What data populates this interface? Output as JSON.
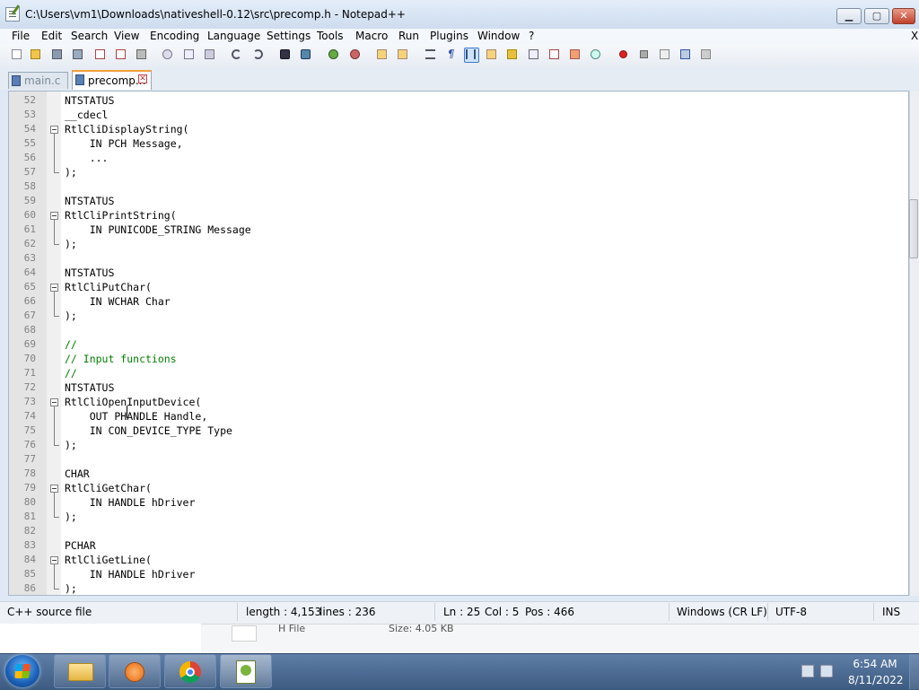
{
  "window": {
    "title": "C:\\Users\\vm1\\Downloads\\nativeshell-0.12\\src\\precomp.h - Notepad++",
    "minimize": "▁",
    "maximize": "▢",
    "close": "✕"
  },
  "menu": [
    "File",
    "Edit",
    "Search",
    "View",
    "Encoding",
    "Language",
    "Settings",
    "Tools",
    "Macro",
    "Run",
    "Plugins",
    "Window",
    "?"
  ],
  "menu_close": "X",
  "toolbar": {
    "icons": [
      "new-file-icon",
      "open-file-icon",
      "save-icon",
      "save-all-icon",
      "close-icon",
      "close-all-icon",
      "print-icon",
      "cut-icon",
      "copy-icon",
      "paste-icon",
      "undo-icon",
      "redo-icon",
      "find-icon",
      "replace-icon",
      "zoom-in-icon",
      "zoom-out-icon",
      "sync-vertical-icon",
      "sync-horizontal-icon",
      "word-wrap-icon",
      "show-all-chars-icon",
      "indent-guide-icon",
      "user-lang-icon",
      "doc-map-icon",
      "function-list-icon",
      "folder-workspace-icon",
      "monitoring-icon",
      "record-macro-icon",
      "stop-record-icon",
      "play-macro-icon",
      "run-macro-multiple-icon",
      "save-macro-icon"
    ]
  },
  "tabs": [
    {
      "label": "main.c",
      "active": false
    },
    {
      "label": "precomp.h",
      "active": true
    }
  ],
  "editor": {
    "lines": [
      {
        "n": "52",
        "text": "NTSTATUS"
      },
      {
        "n": "53",
        "text": "__cdecl"
      },
      {
        "n": "54",
        "text": "RtlCliDisplayString("
      },
      {
        "n": "55",
        "text": "    IN PCH Message,"
      },
      {
        "n": "56",
        "text": "    ..."
      },
      {
        "n": "57",
        "text": ");"
      },
      {
        "n": "58",
        "text": ""
      },
      {
        "n": "59",
        "text": "NTSTATUS"
      },
      {
        "n": "60",
        "text": "RtlCliPrintString("
      },
      {
        "n": "61",
        "text": "    IN PUNICODE_STRING Message"
      },
      {
        "n": "62",
        "text": ");"
      },
      {
        "n": "63",
        "text": ""
      },
      {
        "n": "64",
        "text": "NTSTATUS"
      },
      {
        "n": "65",
        "text": "RtlCliPutChar("
      },
      {
        "n": "66",
        "text": "    IN WCHAR Char"
      },
      {
        "n": "67",
        "text": ");"
      },
      {
        "n": "68",
        "text": ""
      },
      {
        "n": "69",
        "text": "//"
      },
      {
        "n": "70",
        "text": "// Input functions"
      },
      {
        "n": "71",
        "text": "//"
      },
      {
        "n": "72",
        "text": "NTSTATUS"
      },
      {
        "n": "73",
        "text": "RtlCliOpenInputDevice("
      },
      {
        "n": "74",
        "text": "    OUT PHANDLE Handle,"
      },
      {
        "n": "75",
        "text": "    IN CON_DEVICE_TYPE Type"
      },
      {
        "n": "76",
        "text": ");"
      },
      {
        "n": "77",
        "text": ""
      },
      {
        "n": "78",
        "text": "CHAR"
      },
      {
        "n": "79",
        "text": "RtlCliGetChar("
      },
      {
        "n": "80",
        "text": "    IN HANDLE hDriver"
      },
      {
        "n": "81",
        "text": ");"
      },
      {
        "n": "82",
        "text": ""
      },
      {
        "n": "83",
        "text": "PCHAR"
      },
      {
        "n": "84",
        "text": "RtlCliGetLine("
      },
      {
        "n": "85",
        "text": "    IN HANDLE hDriver"
      },
      {
        "n": "86",
        "text": ");"
      }
    ]
  },
  "statusbar": {
    "filetype": "C++ source file",
    "length": "length : 4,153",
    "lines": "lines : 236",
    "ln": "Ln : 25",
    "col": "Col : 5",
    "pos": "Pos : 466",
    "eol": "Windows (CR LF)",
    "encoding": "UTF-8",
    "mode": "INS"
  },
  "behind_window": {
    "type": "H File",
    "size": "Size: 4.05 KB"
  },
  "taskbar": {
    "time": "6:54 AM",
    "date": "8/11/2022",
    "apps": [
      "explorer-icon",
      "media-player-icon",
      "chrome-icon",
      "notepadpp-icon"
    ]
  }
}
